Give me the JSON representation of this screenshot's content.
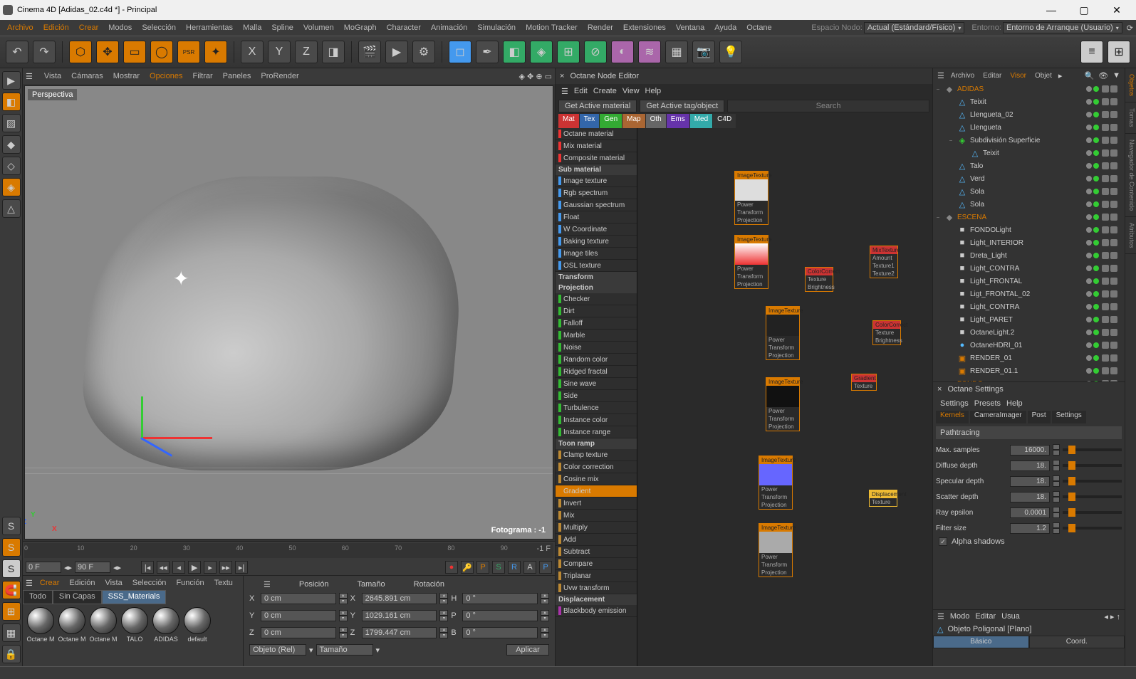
{
  "window": {
    "title": "Cinema 4D   [Adidas_02.c4d *] - Principal",
    "min": "—",
    "max": "▢",
    "close": "✕"
  },
  "menubar": {
    "items": [
      "Archivo",
      "Edición",
      "Crear",
      "Modos",
      "Selección",
      "Herramientas",
      "Malla",
      "Spline",
      "Volumen",
      "MoGraph",
      "Character",
      "Animación",
      "Simulación",
      "Motion Tracker",
      "Render",
      "Extensiones",
      "Ventana",
      "Ayuda",
      "Octane"
    ],
    "workspace_lbl": "Espacio Nodo:",
    "workspace_val": "Actual (Estándard/Físico)",
    "env_lbl": "Entorno:",
    "env_val": "Entorno de Arranque (Usuario)"
  },
  "viewport": {
    "menu": [
      "Vista",
      "Cámaras",
      "Mostrar",
      "Opciones",
      "Filtrar",
      "Paneles",
      "ProRender"
    ],
    "label": "Perspectiva",
    "frame": "Fotograma : -1"
  },
  "timeline": {
    "start": "0 F",
    "end": "90 F",
    "cur": "-1 F",
    "ticks": [
      "0",
      "10",
      "20",
      "30",
      "40",
      "50",
      "60",
      "70",
      "80",
      "90"
    ]
  },
  "materials": {
    "menu": [
      "Crear",
      "Edición",
      "Vista",
      "Selección",
      "Función",
      "Textu"
    ],
    "tabs": [
      "Todo",
      "Sin Capas",
      "SSS_Materials"
    ],
    "items": [
      "Octane M",
      "Octane M",
      "Octane M",
      "TALO",
      "ADIDAS",
      "default"
    ]
  },
  "coords": {
    "hdr": [
      "Posición",
      "Tamaño",
      "Rotación"
    ],
    "x": {
      "p": "0 cm",
      "s": "2645.891 cm",
      "r": "0 °",
      "a": "X",
      "h": "H"
    },
    "y": {
      "p": "0 cm",
      "s": "1029.161 cm",
      "r": "0 °",
      "a": "Y",
      "p2": "P"
    },
    "z": {
      "p": "0 cm",
      "s": "1799.447 cm",
      "r": "0 °",
      "a": "Z",
      "b": "B"
    },
    "mode1": "Objeto (Rel)",
    "mode2": "Tamaño",
    "apply": "Aplicar"
  },
  "node_editor": {
    "title": "Octane Node Editor",
    "menu": [
      "Edit",
      "Create",
      "View",
      "Help"
    ],
    "btns": [
      "Get Active material",
      "Get Active tag/object"
    ],
    "search": "Search",
    "tabs": [
      {
        "l": "Mat",
        "c": "#c33"
      },
      {
        "l": "Tex",
        "c": "#36a"
      },
      {
        "l": "Gen",
        "c": "#3a3"
      },
      {
        "l": "Map",
        "c": "#a63"
      },
      {
        "l": "Oth",
        "c": "#666"
      },
      {
        "l": "Ems",
        "c": "#63a"
      },
      {
        "l": "Med",
        "c": "#3aa"
      },
      {
        "l": "C4D",
        "c": "#333"
      }
    ],
    "list": [
      {
        "t": "item",
        "l": "Octane material",
        "c": "#e33"
      },
      {
        "t": "item",
        "l": "Mix material",
        "c": "#e33"
      },
      {
        "t": "item",
        "l": "Composite material",
        "c": "#e33"
      },
      {
        "t": "hdr",
        "l": "Sub material"
      },
      {
        "t": "item",
        "l": "Image texture",
        "c": "#49e"
      },
      {
        "t": "item",
        "l": "Rgb spectrum",
        "c": "#49e"
      },
      {
        "t": "item",
        "l": "Gaussian spectrum",
        "c": "#49e"
      },
      {
        "t": "item",
        "l": "Float",
        "c": "#49e"
      },
      {
        "t": "item",
        "l": "W Coordinate",
        "c": "#49e"
      },
      {
        "t": "item",
        "l": "Baking texture",
        "c": "#49e"
      },
      {
        "t": "item",
        "l": "Image tiles",
        "c": "#49e"
      },
      {
        "t": "item",
        "l": "OSL texture",
        "c": "#49e"
      },
      {
        "t": "hdr",
        "l": "Transform"
      },
      {
        "t": "hdr",
        "l": "Projection"
      },
      {
        "t": "item",
        "l": "Checker",
        "c": "#3b3"
      },
      {
        "t": "item",
        "l": "Dirt",
        "c": "#3b3"
      },
      {
        "t": "item",
        "l": "Falloff",
        "c": "#3b3"
      },
      {
        "t": "item",
        "l": "Marble",
        "c": "#3b3"
      },
      {
        "t": "item",
        "l": "Noise",
        "c": "#3b3"
      },
      {
        "t": "item",
        "l": "Random color",
        "c": "#3b3"
      },
      {
        "t": "item",
        "l": "Ridged fractal",
        "c": "#3b3"
      },
      {
        "t": "item",
        "l": "Sine wave",
        "c": "#3b3"
      },
      {
        "t": "item",
        "l": "Side",
        "c": "#3b3"
      },
      {
        "t": "item",
        "l": "Turbulence",
        "c": "#3b3"
      },
      {
        "t": "item",
        "l": "Instance color",
        "c": "#3b3"
      },
      {
        "t": "item",
        "l": "Instance range",
        "c": "#3b3"
      },
      {
        "t": "hdr",
        "l": "Toon ramp"
      },
      {
        "t": "item",
        "l": "Clamp texture",
        "c": "#b83"
      },
      {
        "t": "item",
        "l": "Color correction",
        "c": "#b83"
      },
      {
        "t": "item",
        "l": "Cosine mix",
        "c": "#b83"
      },
      {
        "t": "item",
        "l": "Gradient",
        "c": "#d97a00",
        "sel": true
      },
      {
        "t": "item",
        "l": "Invert",
        "c": "#b83"
      },
      {
        "t": "item",
        "l": "Mix",
        "c": "#b83"
      },
      {
        "t": "item",
        "l": "Multiply",
        "c": "#b83"
      },
      {
        "t": "item",
        "l": "Add",
        "c": "#b83"
      },
      {
        "t": "item",
        "l": "Subtract",
        "c": "#b83"
      },
      {
        "t": "item",
        "l": "Compare",
        "c": "#b83"
      },
      {
        "t": "item",
        "l": "Triplanar",
        "c": "#b83"
      },
      {
        "t": "item",
        "l": "Uvw transform",
        "c": "#b83"
      },
      {
        "t": "hdr",
        "l": "Displacement"
      },
      {
        "t": "item",
        "l": "Blackbody emission",
        "c": "#a3a"
      }
    ]
  },
  "objects": {
    "menu": [
      "Archivo",
      "Editar",
      "Visor",
      "Objet"
    ],
    "items": [
      {
        "d": 0,
        "exp": "−",
        "ico": "◆",
        "c": "#888",
        "n": "ADIDAS",
        "hdr": true
      },
      {
        "d": 1,
        "ico": "△",
        "c": "#5bf",
        "n": "Teixit"
      },
      {
        "d": 1,
        "ico": "△",
        "c": "#5bf",
        "n": "Llengueta_02"
      },
      {
        "d": 1,
        "ico": "△",
        "c": "#5bf",
        "n": "Llengueta"
      },
      {
        "d": 1,
        "exp": "−",
        "ico": "◈",
        "c": "#3c3",
        "n": "Subdivisión Superficie"
      },
      {
        "d": 2,
        "ico": "△",
        "c": "#5bf",
        "n": "Teixit"
      },
      {
        "d": 1,
        "ico": "△",
        "c": "#5bf",
        "n": "Talo"
      },
      {
        "d": 1,
        "ico": "△",
        "c": "#5bf",
        "n": "Verd"
      },
      {
        "d": 1,
        "ico": "△",
        "c": "#5bf",
        "n": "Sola"
      },
      {
        "d": 1,
        "ico": "△",
        "c": "#5bf",
        "n": "Sola"
      },
      {
        "d": 0,
        "exp": "−",
        "ico": "◆",
        "c": "#888",
        "n": "ESCENA",
        "hdr": true
      },
      {
        "d": 1,
        "ico": "■",
        "c": "#ccc",
        "n": "FONDOLight"
      },
      {
        "d": 1,
        "ico": "■",
        "c": "#ccc",
        "n": "Light_INTERIOR"
      },
      {
        "d": 1,
        "ico": "■",
        "c": "#ccc",
        "n": "Dreta_Light"
      },
      {
        "d": 1,
        "ico": "■",
        "c": "#ccc",
        "n": "Light_CONTRA"
      },
      {
        "d": 1,
        "ico": "■",
        "c": "#ccc",
        "n": "Light_FRONTAL"
      },
      {
        "d": 1,
        "ico": "■",
        "c": "#ccc",
        "n": "Ligt_FRONTAL_02"
      },
      {
        "d": 1,
        "ico": "■",
        "c": "#ccc",
        "n": "Light_CONTRA"
      },
      {
        "d": 1,
        "ico": "■",
        "c": "#ccc",
        "n": "Light_PARET"
      },
      {
        "d": 1,
        "ico": "■",
        "c": "#ccc",
        "n": "OctaneLight.2"
      },
      {
        "d": 1,
        "ico": "●",
        "c": "#5bf",
        "n": "OctaneHDRI_01"
      },
      {
        "d": 1,
        "ico": "▣",
        "c": "#d97a00",
        "n": "RENDER_01"
      },
      {
        "d": 1,
        "ico": "▣",
        "c": "#d97a00",
        "n": "RENDER_01.1"
      },
      {
        "d": 0,
        "exp": "+",
        "ico": "◆",
        "c": "#3c3",
        "n": "FONDO",
        "hdr": true
      }
    ]
  },
  "octane_settings": {
    "title": "Octane Settings",
    "menu": [
      "Settings",
      "Presets",
      "Help"
    ],
    "tabs": [
      "Kernels",
      "CameraImager",
      "Post",
      "Settings"
    ],
    "kernel": "Pathtracing",
    "rows": [
      {
        "l": "Max. samples",
        "v": "16000."
      },
      {
        "l": "Diffuse depth",
        "v": "18."
      },
      {
        "l": "Specular depth",
        "v": "18."
      },
      {
        "l": "Scatter depth",
        "v": "18."
      },
      {
        "l": "Ray epsilon",
        "v": "0.0001"
      },
      {
        "l": "Filter size",
        "v": "1.2"
      }
    ],
    "alpha": "Alpha shadows"
  },
  "attribs": {
    "menu": [
      "Modo",
      "Editar",
      "Usua"
    ],
    "obj": "Objeto Poligonal [Plano]",
    "tabs": [
      "Básico",
      "Coord."
    ]
  },
  "right_tabs": [
    "Objetos",
    "Tomas",
    "Navegador de Contenido",
    "Atributos"
  ]
}
